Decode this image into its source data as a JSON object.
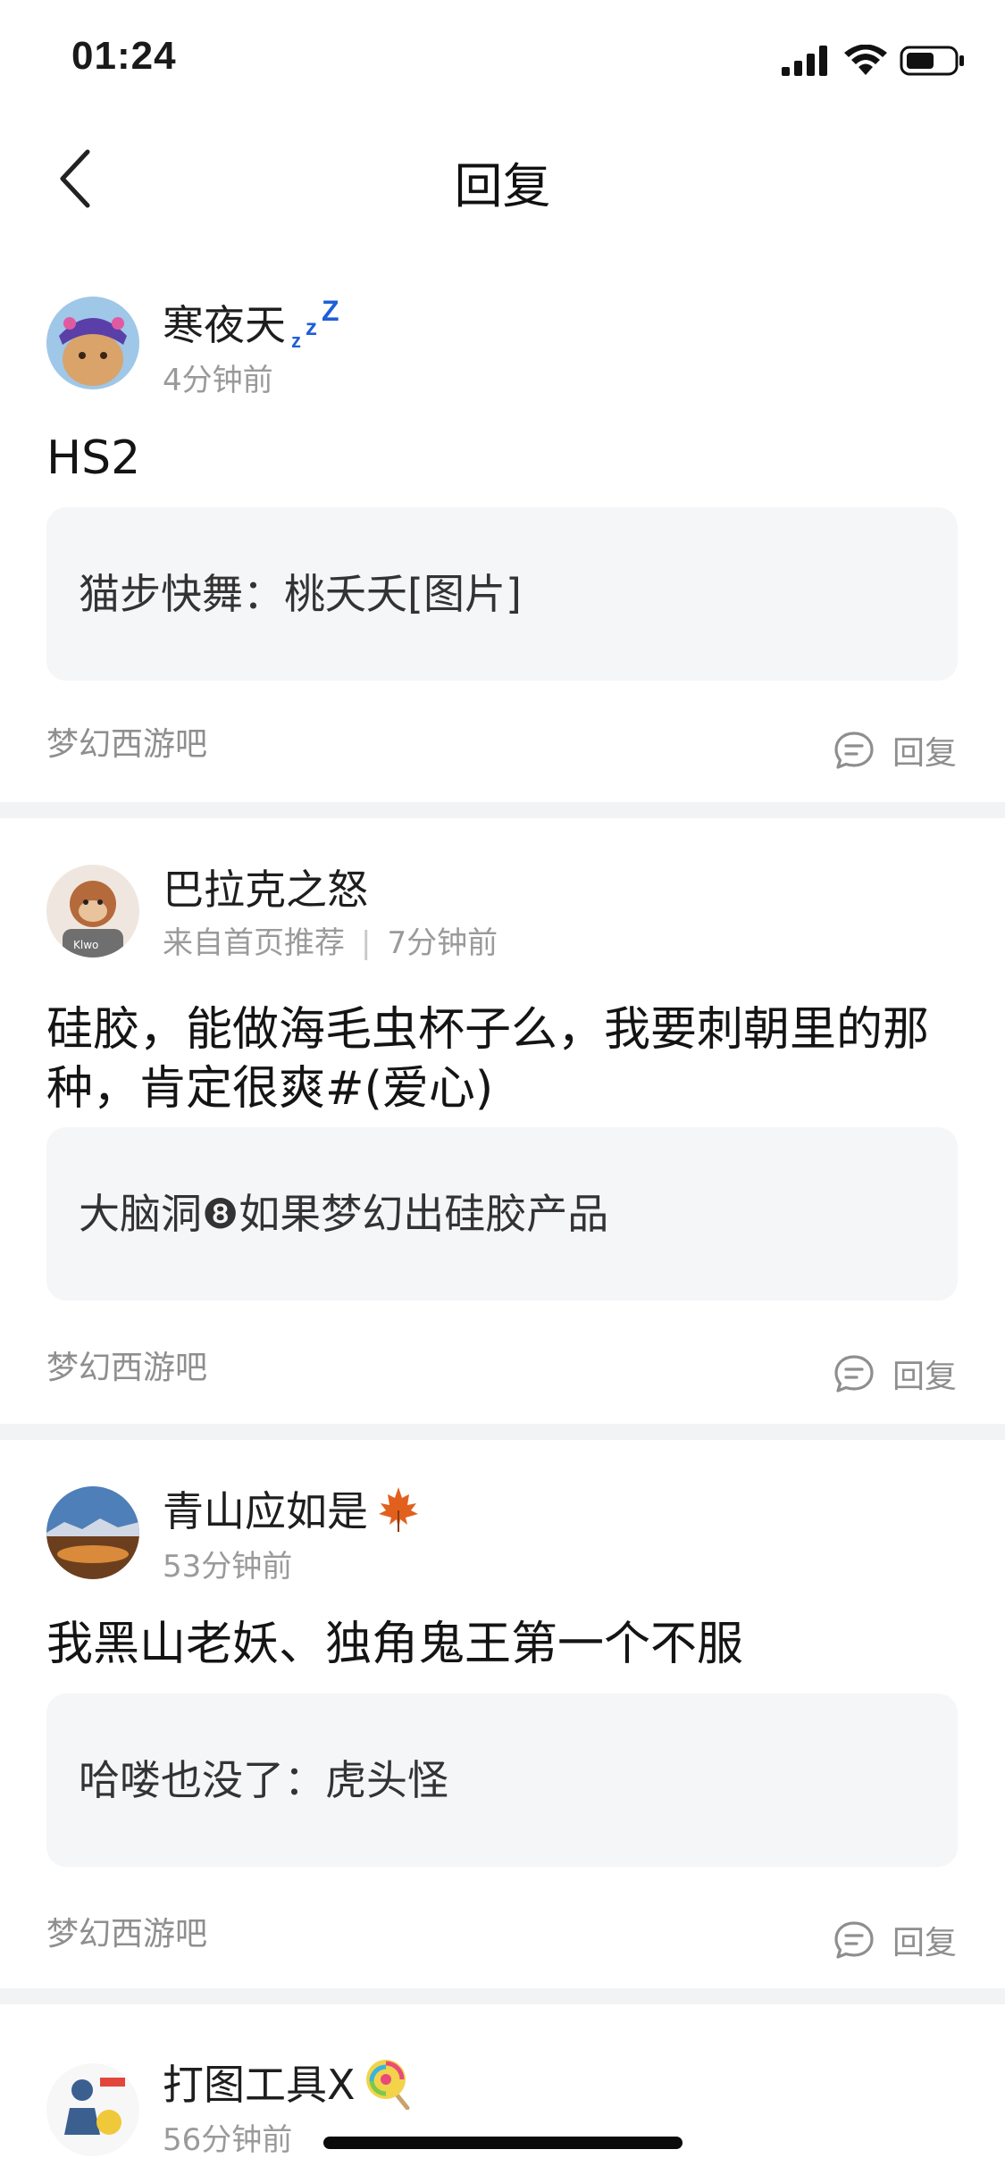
{
  "status_bar": {
    "time": "01:24",
    "icons": [
      "signal-icon",
      "wifi-icon",
      "battery-icon"
    ]
  },
  "nav": {
    "back_icon": "chevron-left-icon",
    "title": "回复"
  },
  "replies": [
    {
      "user": "寒夜天",
      "badge_icon": "zzz-icon",
      "meta": "4分钟前",
      "source": "",
      "comment": "HS2",
      "quote": "猫步快舞：桃夭夭[图片]",
      "forum": "梦幻西游吧",
      "reply_label": "回复"
    },
    {
      "user": "巴拉克之怒",
      "badge_icon": "",
      "meta": "7分钟前",
      "source": "来自首页推荐",
      "comment": "硅胶，能做海毛虫杯子么，我要刺朝里的那种，肯定很爽#(爱心)",
      "quote": "大脑洞❽如果梦幻出硅胶产品",
      "forum": "梦幻西游吧",
      "reply_label": "回复"
    },
    {
      "user": "青山应如是",
      "badge_icon": "maple-leaf-icon",
      "meta": "53分钟前",
      "source": "",
      "comment": "我黑山老妖、独角鬼王第一个不服",
      "quote": "哈喽也没了：虎头怪",
      "forum": "梦幻西游吧",
      "reply_label": "回复"
    },
    {
      "user": "打图工具Ⅹ",
      "badge_icon": "lollipop-icon",
      "meta": "56分钟前",
      "source": "",
      "comment": "",
      "quote": "",
      "forum": "",
      "reply_label": ""
    }
  ],
  "colors": {
    "background": "#ffffff",
    "separator": "#f2f3f5",
    "quote_bg": "#f5f6f8",
    "muted_text": "#9a9a9a",
    "zzz_blue": "#1f5fd6"
  }
}
